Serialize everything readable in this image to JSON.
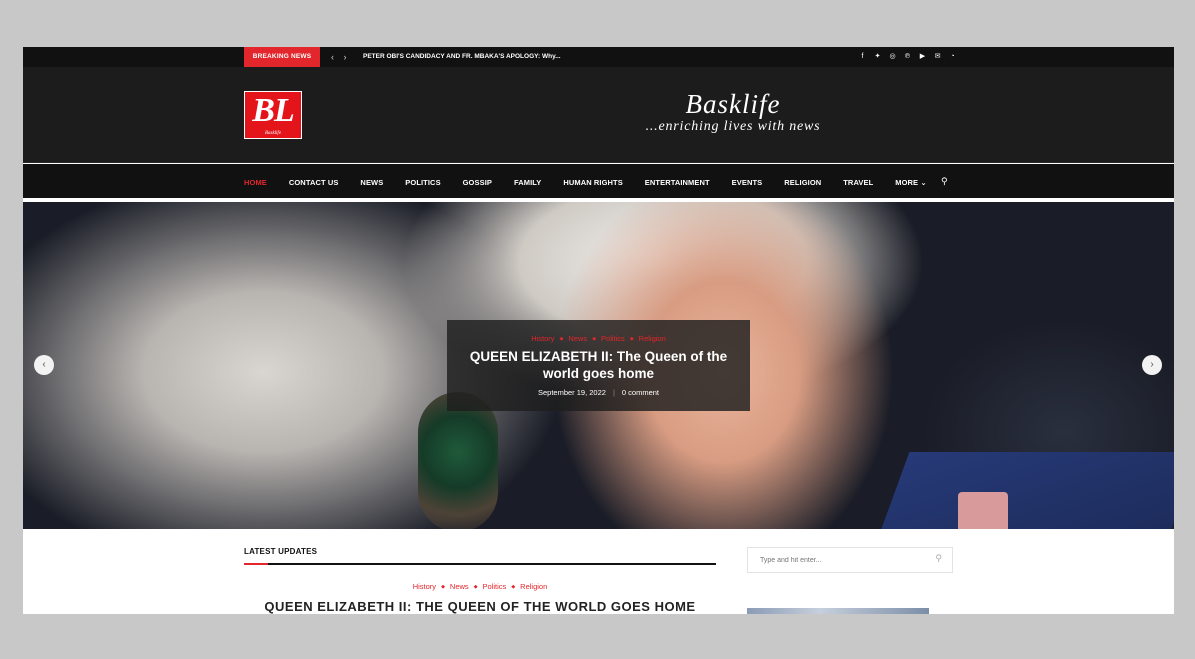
{
  "topbar": {
    "breaking_label": "BREAKING NEWS",
    "prev": "‹",
    "next": "›",
    "ticker": "PETER OBI'S CANDIDACY AND FR. MBAKA'S APOLOGY: Why...",
    "socials": [
      "facebook-icon",
      "twitter-icon",
      "instagram-icon",
      "pinterest-icon",
      "youtube-icon",
      "envelope-icon",
      "rss-icon"
    ]
  },
  "header": {
    "logo_text": "BL",
    "logo_small": "Basklife",
    "brand": "Basklife",
    "tagline": "...enriching lives with news"
  },
  "nav": {
    "items": [
      "HOME",
      "CONTACT US",
      "NEWS",
      "POLITICS",
      "GOSSIP",
      "FAMILY",
      "HUMAN RIGHTS",
      "ENTERTAINMENT",
      "EVENTS",
      "RELIGION",
      "TRAVEL",
      "MORE ⌄"
    ],
    "active": "HOME"
  },
  "hero": {
    "categories": [
      "History",
      "News",
      "Politics",
      "Religion"
    ],
    "title": "QUEEN ELIZABETH II: The Queen of the world goes home",
    "date": "September 19, 2022",
    "divider": "|",
    "comments": "0 comment",
    "prev": "‹",
    "next": "›"
  },
  "content": {
    "section_label": "LATEST UPDATES",
    "post_categories": [
      "History",
      "News",
      "Politics",
      "Religion"
    ],
    "post_title": "QUEEN ELIZABETH II: THE QUEEN OF THE WORLD GOES HOME"
  },
  "sidebar": {
    "search_placeholder": "Type and hit enter..."
  },
  "colors": {
    "accent": "#e3262b",
    "topbar_bg": "#111111",
    "header_bg": "#1c1c1c"
  }
}
